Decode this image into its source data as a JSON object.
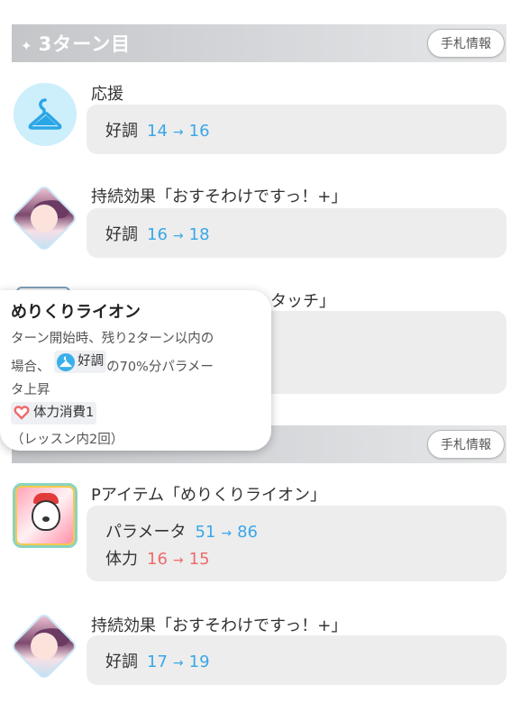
{
  "turn_headers": [
    {
      "title": "3ターン目",
      "hand_button": "手札情報"
    },
    {
      "title": "",
      "hand_button": "手札情報"
    }
  ],
  "entries": [
    {
      "title": "応援",
      "icon": "hanger-icon",
      "stats": [
        {
          "label": "好調",
          "from": "14",
          "to": "16",
          "color": "#3aa7e8"
        }
      ]
    },
    {
      "title": "持続効果「おすそわけですっ！+」",
      "icon": "idol-portrait-icon",
      "stats": [
        {
          "label": "好調",
          "from": "16",
          "to": "18",
          "color": "#3aa7e8"
        }
      ]
    },
    {
      "title": "タッチ」",
      "icon": "card-icon"
    },
    {
      "title": "Pアイテム「めりくりライオン」",
      "icon": "lion-item-icon",
      "stats": [
        {
          "label": "パラメータ",
          "from": "51",
          "to": "86",
          "color": "#3aa7e8"
        },
        {
          "label": "体力",
          "from": "16",
          "to": "15",
          "color": "#f06a6a"
        }
      ]
    },
    {
      "title": "持続効果「おすそわけですっ！+」",
      "icon": "idol-portrait-icon",
      "stats": [
        {
          "label": "好調",
          "from": "17",
          "to": "19",
          "color": "#3aa7e8"
        }
      ]
    }
  ],
  "tooltip": {
    "title": "めりくりライオン",
    "line1": "ターン開始時、残り2ターン以内の",
    "line2_prefix": "場合、",
    "chip": "好調",
    "line2_suffix": "の70%分パラメー",
    "line3": "タ上昇",
    "cost": "体力消費1",
    "limit": "（レッスン内2回）"
  },
  "arrow": "→",
  "spark": "✦"
}
